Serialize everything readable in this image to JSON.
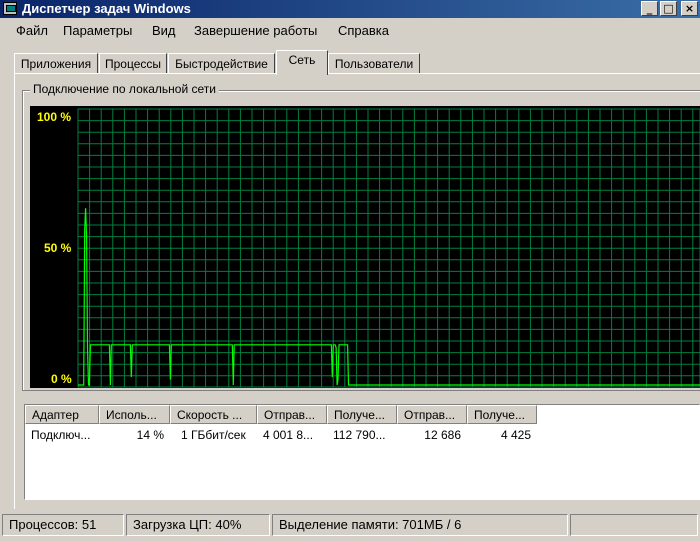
{
  "window": {
    "title": "Диспетчер задач Windows",
    "buttons": {
      "minimize": "_",
      "maximize": "□",
      "close": "×"
    }
  },
  "menu": {
    "items": [
      "Файл",
      "Параметры",
      "Вид",
      "Завершение работы",
      "Справка"
    ]
  },
  "tabs": {
    "items": [
      "Приложения",
      "Процессы",
      "Быстродействие",
      "Сеть",
      "Пользователи"
    ],
    "active": "Сеть"
  },
  "network_graph": {
    "title": "Подключение по локальной сети",
    "y_labels": [
      "100 %",
      "50 %",
      "0 %"
    ],
    "colors": {
      "background": "#000000",
      "grid": "#008040",
      "line": "#00ff00",
      "labels": "#ffff00"
    },
    "chart_data": {
      "type": "line",
      "title": "Подключение по локальной сети",
      "ylim": [
        0,
        100
      ],
      "y_ticks": [
        "0 %",
        "50 %",
        "100 %"
      ],
      "grid": true,
      "series": [
        {
          "values": [
            0,
            0,
            0,
            0,
            0,
            0,
            0,
            58,
            66,
            55,
            14,
            0,
            0,
            15,
            15,
            15,
            15,
            15,
            15,
            15,
            15,
            15,
            15,
            15,
            15,
            15,
            15,
            15,
            15,
            15,
            15,
            15,
            15,
            15,
            0,
            15,
            15,
            15,
            15,
            15,
            15,
            15,
            15,
            15,
            15,
            15,
            15,
            15,
            15,
            15,
            15,
            15,
            15,
            15,
            15,
            15,
            3,
            15,
            15,
            15,
            15,
            15,
            15,
            15,
            15,
            15,
            15,
            15,
            15,
            15,
            15,
            15,
            15,
            15,
            15,
            15,
            15,
            15,
            15,
            15,
            15,
            15,
            15,
            15,
            15,
            15,
            15,
            15,
            15,
            15,
            15,
            15,
            15,
            15,
            15,
            15,
            15,
            2,
            15,
            15,
            15,
            15,
            15,
            15,
            15,
            15,
            15,
            15,
            15,
            15,
            15,
            15,
            15,
            15,
            15,
            15,
            15,
            15,
            15,
            15,
            15,
            15,
            15,
            15,
            15,
            15,
            15,
            15,
            15,
            15,
            15,
            15,
            15,
            15,
            15,
            15,
            15,
            15,
            15,
            15,
            15,
            15,
            15,
            15,
            15,
            15,
            15,
            15,
            15,
            15,
            15,
            15,
            15,
            15,
            15,
            15,
            15,
            15,
            15,
            15,
            15,
            15,
            15,
            0,
            15,
            15,
            15,
            15,
            15,
            15,
            15,
            15,
            15,
            15,
            15,
            15,
            15,
            15,
            15,
            15,
            15,
            15,
            15,
            15,
            15,
            15,
            15,
            15,
            15,
            15,
            15,
            15,
            15,
            15,
            15,
            15,
            15,
            15,
            15,
            15,
            15,
            15,
            15,
            15,
            15,
            15,
            15,
            15,
            15,
            15,
            15,
            15,
            15,
            15,
            15,
            15,
            15,
            15,
            15,
            15,
            15,
            15,
            15,
            15,
            15,
            15,
            15,
            15,
            15,
            15,
            15,
            15,
            15,
            15,
            15,
            15,
            15,
            15,
            15,
            15,
            15,
            15,
            15,
            15,
            15,
            15,
            15,
            15,
            15,
            15,
            15,
            15,
            15,
            15,
            15,
            15,
            15,
            15,
            15,
            15,
            15,
            15,
            15,
            15,
            15,
            15,
            15,
            3,
            15,
            15,
            15,
            14,
            0,
            2,
            15,
            15,
            15,
            15,
            15,
            15,
            15,
            15,
            15,
            15,
            0,
            0,
            0,
            0,
            0,
            0,
            0,
            0,
            0,
            0,
            0,
            0,
            0,
            0,
            0,
            0,
            0,
            0,
            0,
            0,
            0,
            0,
            0,
            0,
            0,
            0,
            0,
            0,
            0,
            0,
            0,
            0,
            0,
            0,
            0,
            0,
            0,
            0,
            0,
            0,
            0,
            0,
            0,
            0,
            0,
            0,
            0,
            0,
            0,
            0,
            0,
            0,
            0,
            0,
            0,
            0,
            0,
            0,
            0,
            0,
            0,
            0,
            0,
            0,
            0,
            0,
            0,
            0,
            0,
            0,
            0,
            0,
            0,
            0,
            0,
            0,
            0,
            0,
            0,
            0,
            0,
            0,
            0,
            0,
            0,
            0,
            0,
            0,
            0,
            0,
            0,
            0,
            0,
            0,
            0,
            0,
            0,
            0,
            0,
            0,
            0,
            0,
            0,
            0,
            0,
            0,
            0,
            0,
            0,
            0,
            0,
            0,
            0,
            0,
            0,
            0,
            0,
            0,
            0,
            0,
            0,
            0,
            0,
            0,
            0,
            0,
            0,
            0,
            0,
            0,
            0,
            0,
            0,
            0,
            0,
            0,
            0,
            0,
            0,
            0,
            0,
            0,
            0,
            0,
            0,
            0,
            0,
            0,
            0,
            0,
            0,
            0,
            0,
            0,
            0,
            0,
            0,
            0,
            0,
            0,
            0,
            0,
            0,
            0,
            0,
            0,
            0,
            0,
            0,
            0,
            0,
            0,
            0,
            0,
            0,
            0,
            0,
            0,
            0,
            0,
            0,
            0,
            0,
            0,
            0,
            0,
            0,
            0,
            0,
            0,
            0,
            0,
            0,
            0,
            0,
            0,
            0,
            0,
            0,
            0,
            0,
            0,
            0,
            0,
            0,
            0,
            0,
            0,
            0,
            0,
            0,
            0,
            0,
            0,
            0,
            0,
            0,
            0,
            0,
            0,
            0,
            0,
            0,
            0,
            0,
            0,
            0,
            0,
            0,
            0,
            0,
            0,
            0,
            0,
            0,
            0,
            0,
            0,
            0,
            0,
            0,
            0,
            0,
            0,
            0,
            0,
            0,
            0,
            0,
            0,
            0,
            0,
            0,
            0,
            0,
            0,
            0,
            0,
            0,
            0,
            0,
            0,
            0,
            0,
            0,
            0,
            0,
            0,
            0,
            0,
            0,
            0,
            0,
            0,
            0,
            0,
            0,
            0,
            0,
            0,
            0,
            0,
            0,
            0,
            0,
            0,
            0,
            0,
            0,
            0,
            0,
            0,
            0,
            0,
            0,
            0,
            0,
            0,
            0,
            0,
            0,
            0,
            0,
            0,
            0,
            0,
            0,
            0,
            0,
            0,
            0,
            0,
            0,
            0,
            0,
            0,
            0,
            0,
            0,
            0,
            0,
            0,
            0,
            0,
            0,
            0,
            0,
            0,
            0,
            0,
            0,
            0,
            0,
            0,
            0,
            0,
            0,
            0,
            0,
            0,
            0,
            0,
            0,
            0,
            0,
            0,
            0,
            0,
            0,
            0,
            0,
            0,
            0,
            0,
            0,
            0,
            0,
            0,
            0,
            0,
            0,
            0,
            0,
            0,
            0,
            0,
            0,
            0,
            0,
            0
          ]
        }
      ]
    }
  },
  "adapters_table": {
    "columns": [
      "Адаптер",
      "Исполь...",
      "Скорость ...",
      "Отправ...",
      "Получе...",
      "Отправ...",
      "Получе..."
    ],
    "rows": [
      [
        "Подключ...",
        "14 %",
        "1 ГБбит/сек",
        "4 001 8...",
        "112 790...",
        "12 686",
        "4 425"
      ]
    ]
  },
  "status": {
    "processes": "Процессов: 51",
    "cpu": "Загрузка ЦП: 40%",
    "memory": "Выделение памяти: 701МБ / 6"
  }
}
